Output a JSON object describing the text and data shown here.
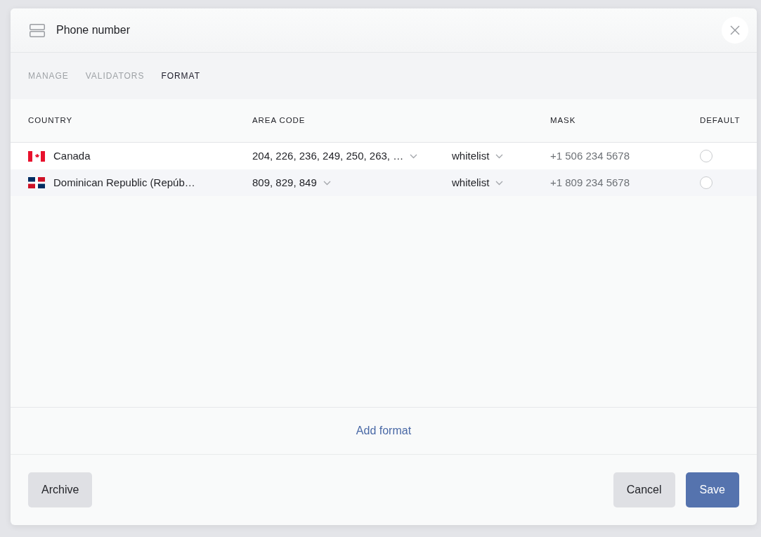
{
  "dialog": {
    "title": "Phone number"
  },
  "tabs": [
    {
      "label": "MANAGE",
      "selected": false
    },
    {
      "label": "VALIDATORS",
      "selected": false
    },
    {
      "label": "FORMAT",
      "selected": true
    }
  ],
  "table": {
    "columns": [
      {
        "label": "COUNTRY"
      },
      {
        "label": "AREA CODE"
      },
      {
        "label": "MASK"
      },
      {
        "label": "DEFAULT"
      }
    ],
    "rows": [
      {
        "flag": {
          "kind": "canada"
        },
        "country": "Canada",
        "area_codes": "204, 226, 236, 249, 250, 263, …",
        "list_type": "whitelist",
        "mask": "+1 506 234 5678",
        "default_radio": {
          "selected": false
        }
      },
      {
        "flag": {
          "kind": "dominican_republic"
        },
        "country": "Dominican Republic (Repúb…",
        "area_codes": "809, 829, 849",
        "list_type": "whitelist",
        "mask": "+1 809 234 5678",
        "default_radio": {
          "selected": false
        }
      }
    ]
  },
  "add_link": "Add format",
  "footer": {
    "left_buttons": [
      {
        "label": "Archive",
        "kind": "secondary"
      }
    ],
    "right_buttons": [
      {
        "label": "Cancel",
        "kind": "secondary"
      },
      {
        "label": "Save",
        "kind": "primary"
      }
    ]
  }
}
